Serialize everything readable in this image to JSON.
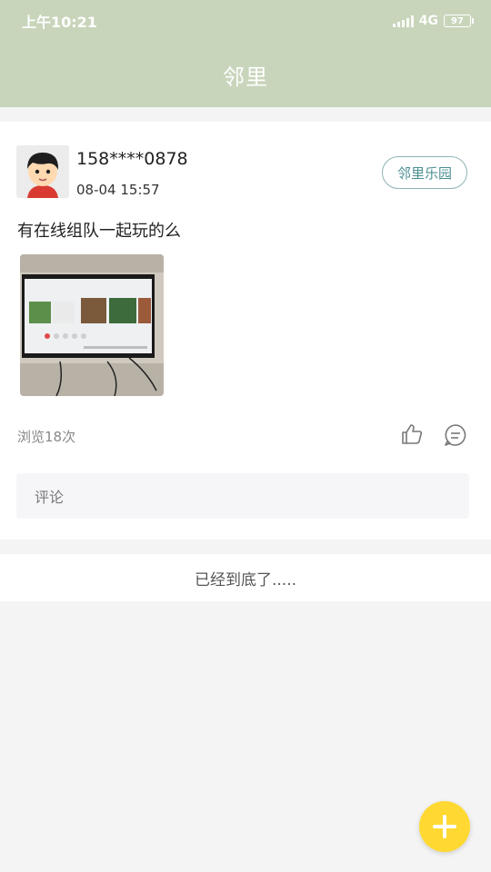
{
  "status_bar": {
    "time": "上午10:21",
    "network": "4G",
    "battery": "97"
  },
  "header": {
    "title": "邻里"
  },
  "post": {
    "username": "158****0878",
    "time": "08-04 15:57",
    "group_tag": "邻里乐园",
    "content": "有在线组队一起玩的么",
    "image_icon": "photo-thumbnail",
    "views": "浏览18次",
    "like_icon": "thumb-up-icon",
    "comment_icon": "comment-bubble-icon",
    "comment_placeholder": "评论"
  },
  "footer": {
    "end_text": "已经到底了....."
  },
  "fab": {
    "icon": "plus-icon"
  },
  "colors": {
    "header_bg": "#c8d5bb",
    "tag_border": "#8fb3b5",
    "fab_bg": "#ffd931"
  }
}
